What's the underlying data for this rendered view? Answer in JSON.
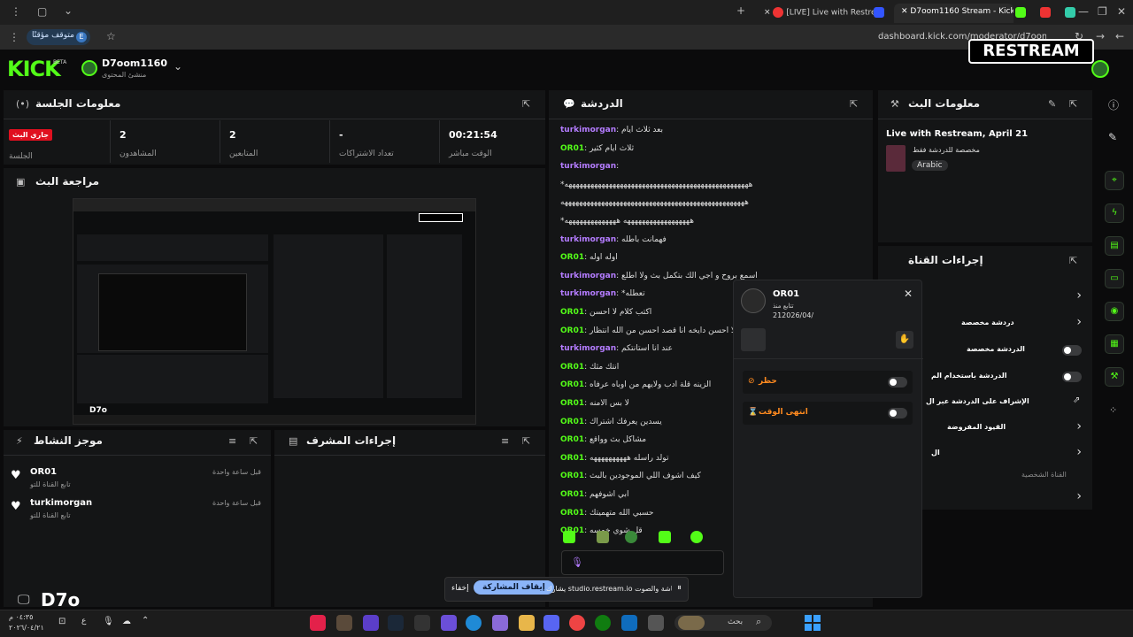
{
  "browser": {
    "tabs": [
      {
        "label": "[LIVE] Live with Restrea",
        "active": false
      },
      {
        "label": "D7oom1160 Stream - Kick Das",
        "active": true
      }
    ],
    "url": "dashboard.kick.com/moderator/d7oom1160",
    "paused_label": "متوقف مؤقتًا",
    "profile_letter": "E"
  },
  "header": {
    "logo": "KICK",
    "beta": "BETA",
    "username": "D7oom1160",
    "role": "منشئ المحتوى",
    "restream": "RESTREAM"
  },
  "session": {
    "title": "معلومات الجلسة",
    "stats": [
      {
        "value": "00:21:54",
        "label": "الوقت مباشر"
      },
      {
        "value": "-",
        "label": "تعداد الاشتراكات"
      },
      {
        "value": "2",
        "label": "المتابعين"
      },
      {
        "value": "2",
        "label": "المشاهدون"
      },
      {
        "value": "جاري البث",
        "label": "الجلسة"
      }
    ]
  },
  "preview": {
    "title": "مراجعة البث",
    "overlay_name": "D7o"
  },
  "activity": {
    "title": "موجز النشاط",
    "items": [
      {
        "user": "OR01",
        "desc": "تابع القناة للتو",
        "time": "قبل ساعة واحدة"
      },
      {
        "user": "turkimorgan",
        "desc": "تابع القناة للتو",
        "time": "قبل ساعة واحدة"
      }
    ]
  },
  "modactions": {
    "title": "إجراءات المشرف"
  },
  "chat": {
    "title": "الدردشة",
    "messages": [
      {
        "user": "turkimorgan",
        "text": "بعد ثلاث ايام",
        "color": "purple"
      },
      {
        "user": "OR01",
        "text": "ثلاث ايام كثير",
        "color": "green"
      },
      {
        "user": "turkimorgan",
        "text": "",
        "color": "purple"
      },
      {
        "user": "",
        "text": "*ههههههههههههههههههههههههههههههههههههههههههههههههههه",
        "color": "none"
      },
      {
        "user": "",
        "text": "ههههههههههههههههههههههههههههههههههههههههههههههههههه",
        "color": "none"
      },
      {
        "user": "",
        "text": "*ههههههههههههههههههه ههههههههههههههه",
        "color": "none"
      },
      {
        "user": "turkimorgan",
        "text": "فهمانت باطله",
        "color": "purple"
      },
      {
        "user": "OR01",
        "text": "اوله اوله",
        "color": "green"
      },
      {
        "user": "turkimorgan",
        "text": "اسمع بروح و اجي الك بتكمل بث ولا اطلع",
        "color": "purple"
      },
      {
        "user": "turkimorgan",
        "text": "*تعطله",
        "color": "purple"
      },
      {
        "user": "OR01",
        "text": "اكتب كلام لا احسن",
        "color": "green"
      },
      {
        "user": "OR01",
        "text": "وش لا احسن دايخه انا قصد احسن من الله انتظار",
        "color": "green"
      },
      {
        "user": "turkimorgan",
        "text": "عند انا استانتكم",
        "color": "purple"
      },
      {
        "user": "OR01",
        "text": "انتك مثك",
        "color": "green"
      },
      {
        "user": "OR01",
        "text": "الزينه قلة ادب ولايهم من اوباه عرفاه",
        "color": "green"
      },
      {
        "user": "OR01",
        "text": "لا بس الامنه",
        "color": "green"
      },
      {
        "user": "OR01",
        "text": "يسدين يعرفك اشتراك",
        "color": "green"
      },
      {
        "user": "OR01",
        "text": "مشاكل بث وواقع",
        "color": "green"
      },
      {
        "user": "OR01",
        "text": "تولد راسله ههههههههههه",
        "color": "green"
      },
      {
        "user": "OR01",
        "text": "كيف اشوف اللي الموجودين بالبث",
        "color": "green"
      },
      {
        "user": "OR01",
        "text": "ابي اشوفهم",
        "color": "green"
      },
      {
        "user": "OR01",
        "text": "حسبي الله متهميتك",
        "color": "green"
      },
      {
        "user": "OR01",
        "text": "قل شوي خمسه",
        "color": "green"
      }
    ]
  },
  "stream_info": {
    "title": "معلومات البث",
    "stream_title": "Live with Restream, April 21",
    "category": "مخصصة للدردشة فقط",
    "language": "Arabic"
  },
  "channel_actions": {
    "title": "إجراءات القناة",
    "items": [
      "دردشة مخصصة",
      "الدردشة مخصصة",
      "الدردشة باستخدام الم",
      "الإشراف على الدردشة عبر ال",
      "القيود المفروضة",
      "ال"
    ],
    "section": "القناة الشخصية"
  },
  "user_card": {
    "name": "OR01",
    "followed_label": "تتابع منذ",
    "followed_date": "212026/04/",
    "ban_label": "حظر",
    "timeout_label": "انتهى الوقت"
  },
  "share_bar": {
    "message": "يشارك studio.restream.io الشاشة والصوت.",
    "stop": "إيقاف المشاركة",
    "hide": "إخفاء"
  },
  "taskbar": {
    "search": "بحث",
    "time": "٠٤:٣٥ م",
    "date": "٢٠٢٦/٠٤/٢١",
    "lang": "ع"
  },
  "colors": {
    "kick_green": "#53fc18",
    "live_red": "#e0101f",
    "panel": "#141516",
    "username_purple": "#b47cff",
    "ban_orange": "#ff8a1f"
  }
}
